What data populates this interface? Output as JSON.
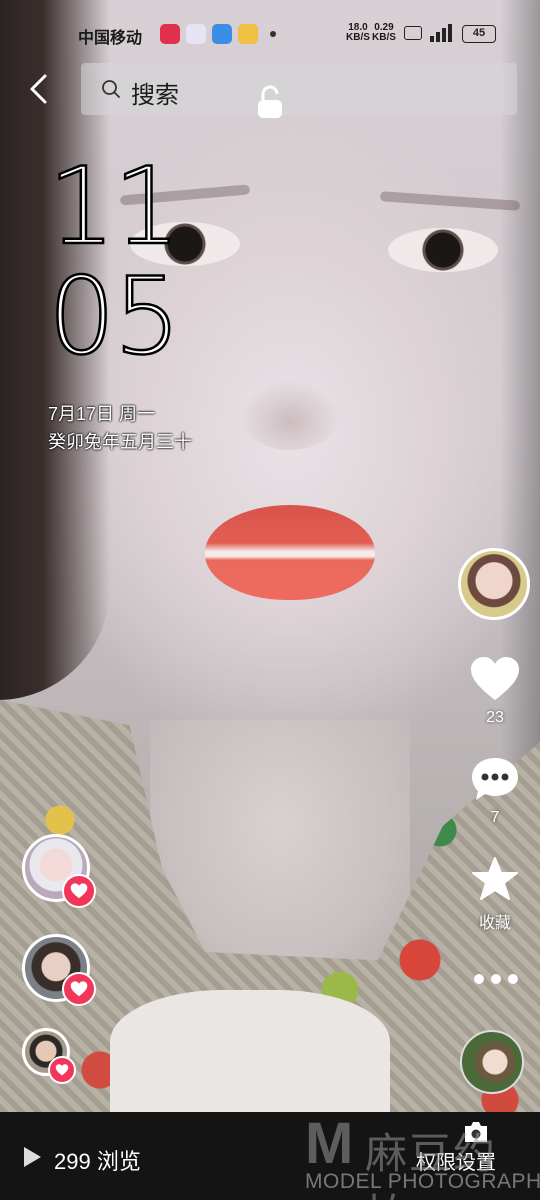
{
  "status_bar": {
    "carrier": "中国移动",
    "net_speed_1": [
      "18.0",
      "KB/S"
    ],
    "net_speed_2": [
      "0.29",
      "KB/S"
    ],
    "battery": "45",
    "icons": [
      "taobao-app-icon",
      "ai-assistant-icon",
      "weather-icon",
      "wallet-icon"
    ]
  },
  "top_bar": {
    "back_icon": "chevron-left-icon",
    "search_placeholder": "搜索",
    "lock_icon": "unlock-icon"
  },
  "lockscreen_preview": {
    "hour": "11",
    "minute": "05",
    "date_line": "7月17日 周一",
    "lunar_line": "癸卯兔年五月三十"
  },
  "side_actions": {
    "like_count": "23",
    "comment_count": "7",
    "favorite_label": "收藏"
  },
  "bottom_bar": {
    "views": "299 浏览",
    "permission_label": "权限设置"
  },
  "watermark": {
    "logo_letter": "M",
    "cn_text": "麻豆约拍",
    "en_text": "MODEL PHOTOGRAPH"
  },
  "colors": {
    "like_badge": "#f1365a",
    "bottom_bar": "#141414",
    "lips": "#e35e52"
  }
}
